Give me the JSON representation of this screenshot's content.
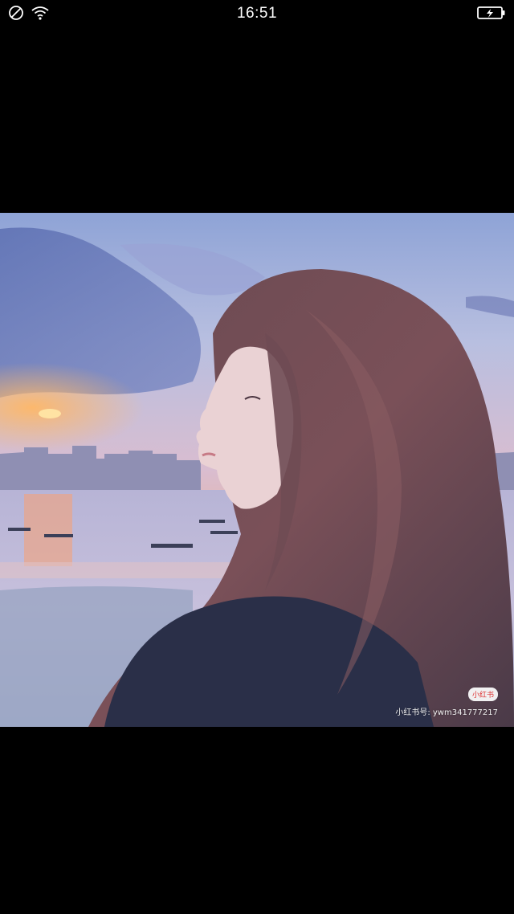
{
  "status_bar": {
    "time": "16:51",
    "icons": [
      "do-not-disturb-icon",
      "wifi-icon",
      "battery-charging-icon"
    ]
  },
  "photo": {
    "watermark_logo": "小红书",
    "watermark_id": "小红书号: ywm341777217"
  }
}
